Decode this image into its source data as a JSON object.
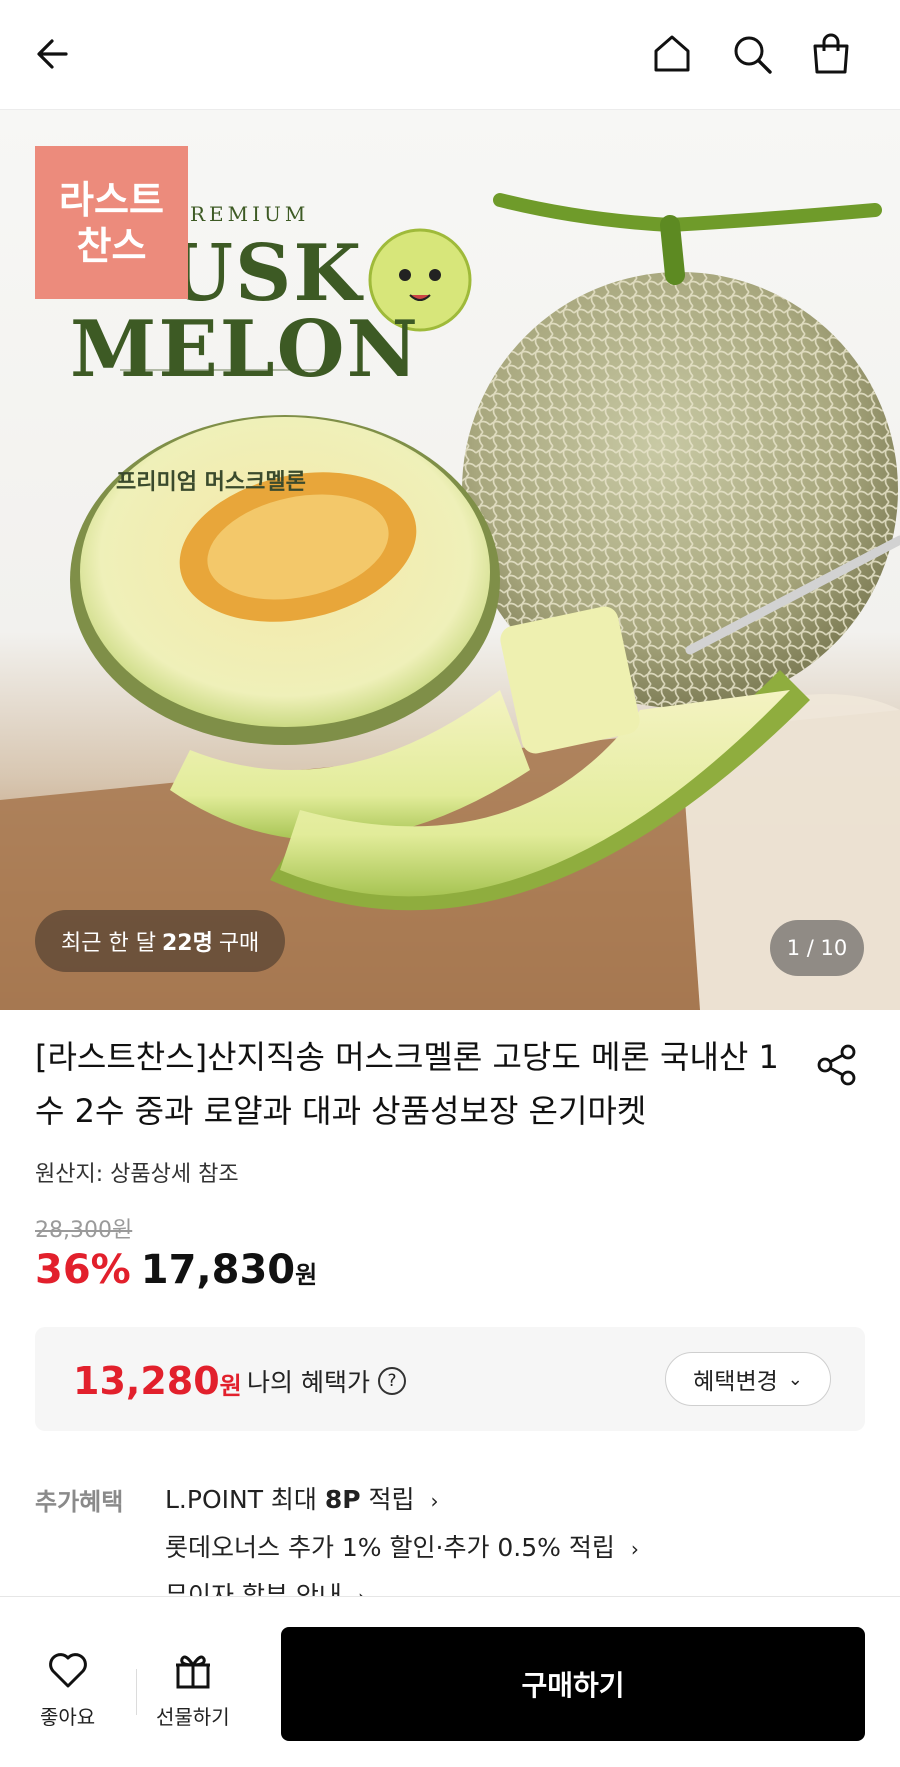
{
  "header": {
    "icons": [
      "back-arrow-icon",
      "home-icon",
      "search-icon",
      "shopping-bag-icon"
    ]
  },
  "hero": {
    "tag": [
      "라스트",
      "찬스"
    ],
    "brand": {
      "premium": "REMIUM",
      "line1": "USK",
      "line2": "MELON",
      "korean": "프리미엄 머스크멜론"
    },
    "recent": {
      "prefix": "최근 한 달",
      "count": "22명",
      "suffix": "구매"
    },
    "pager": "1 / 10"
  },
  "product": {
    "title": "[라스트찬스]산지직송 머스크멜론 고당도 메론 국내산 1수 2수 중과 로얄과 대과 상품성보장 온기마켓",
    "origin": "원산지: 상품상세 참조",
    "original_price": "28,300원",
    "discount": "36%",
    "sale_price": "17,830",
    "currency": "원"
  },
  "benefit": {
    "price": "13,280",
    "currency": "원",
    "label": "나의 혜택가",
    "help": "?",
    "change_button": "혜택변경"
  },
  "extra": {
    "label": "추가혜택",
    "line1_prefix": "L.POINT 최대",
    "line1_bold": "8P",
    "line1_suffix": "적립",
    "line2": "롯데오너스 추가 1% 할인·추가 0.5% 적립",
    "line3": "무이자 할부 안내"
  },
  "bottom": {
    "like": "좋아요",
    "gift": "선물하기",
    "buy": "구매하기"
  },
  "colors": {
    "sale_red": "#e2202c",
    "tag_coral": "#ec8b7c",
    "buy_black": "#000000"
  }
}
